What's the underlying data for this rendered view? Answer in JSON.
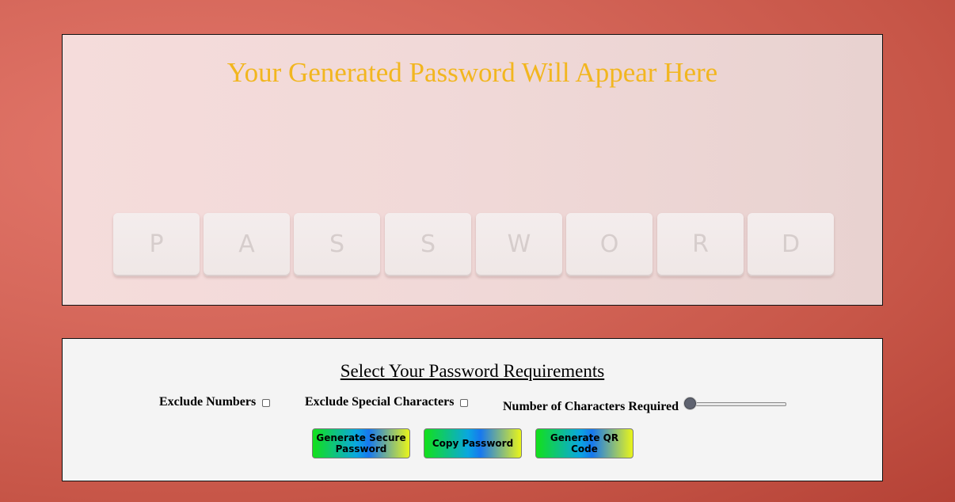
{
  "output": {
    "password_placeholder": "Your Generated Password Will Appear Here"
  },
  "background_image": {
    "keys": [
      "P",
      "A",
      "S",
      "S",
      "W",
      "O",
      "R",
      "D"
    ]
  },
  "requirements": {
    "title": "Select Your Password Requirements",
    "exclude_numbers_label": "Exclude Numbers",
    "exclude_numbers_checked": false,
    "exclude_special_label": "Exclude Special Characters",
    "exclude_special_checked": false,
    "length_label": "Number of Characters Required",
    "length_slider_fraction": 0
  },
  "buttons": {
    "generate_label": "Generate Secure Password",
    "copy_label": "Copy Password",
    "qr_label": "Generate QR Code"
  },
  "colors": {
    "placeholder_text": "#f2b61f",
    "page_background": "#d6685b",
    "button_gradient_start": "#13e01a",
    "button_gradient_mid": "#1778ef",
    "button_gradient_end": "#e9f51a"
  }
}
